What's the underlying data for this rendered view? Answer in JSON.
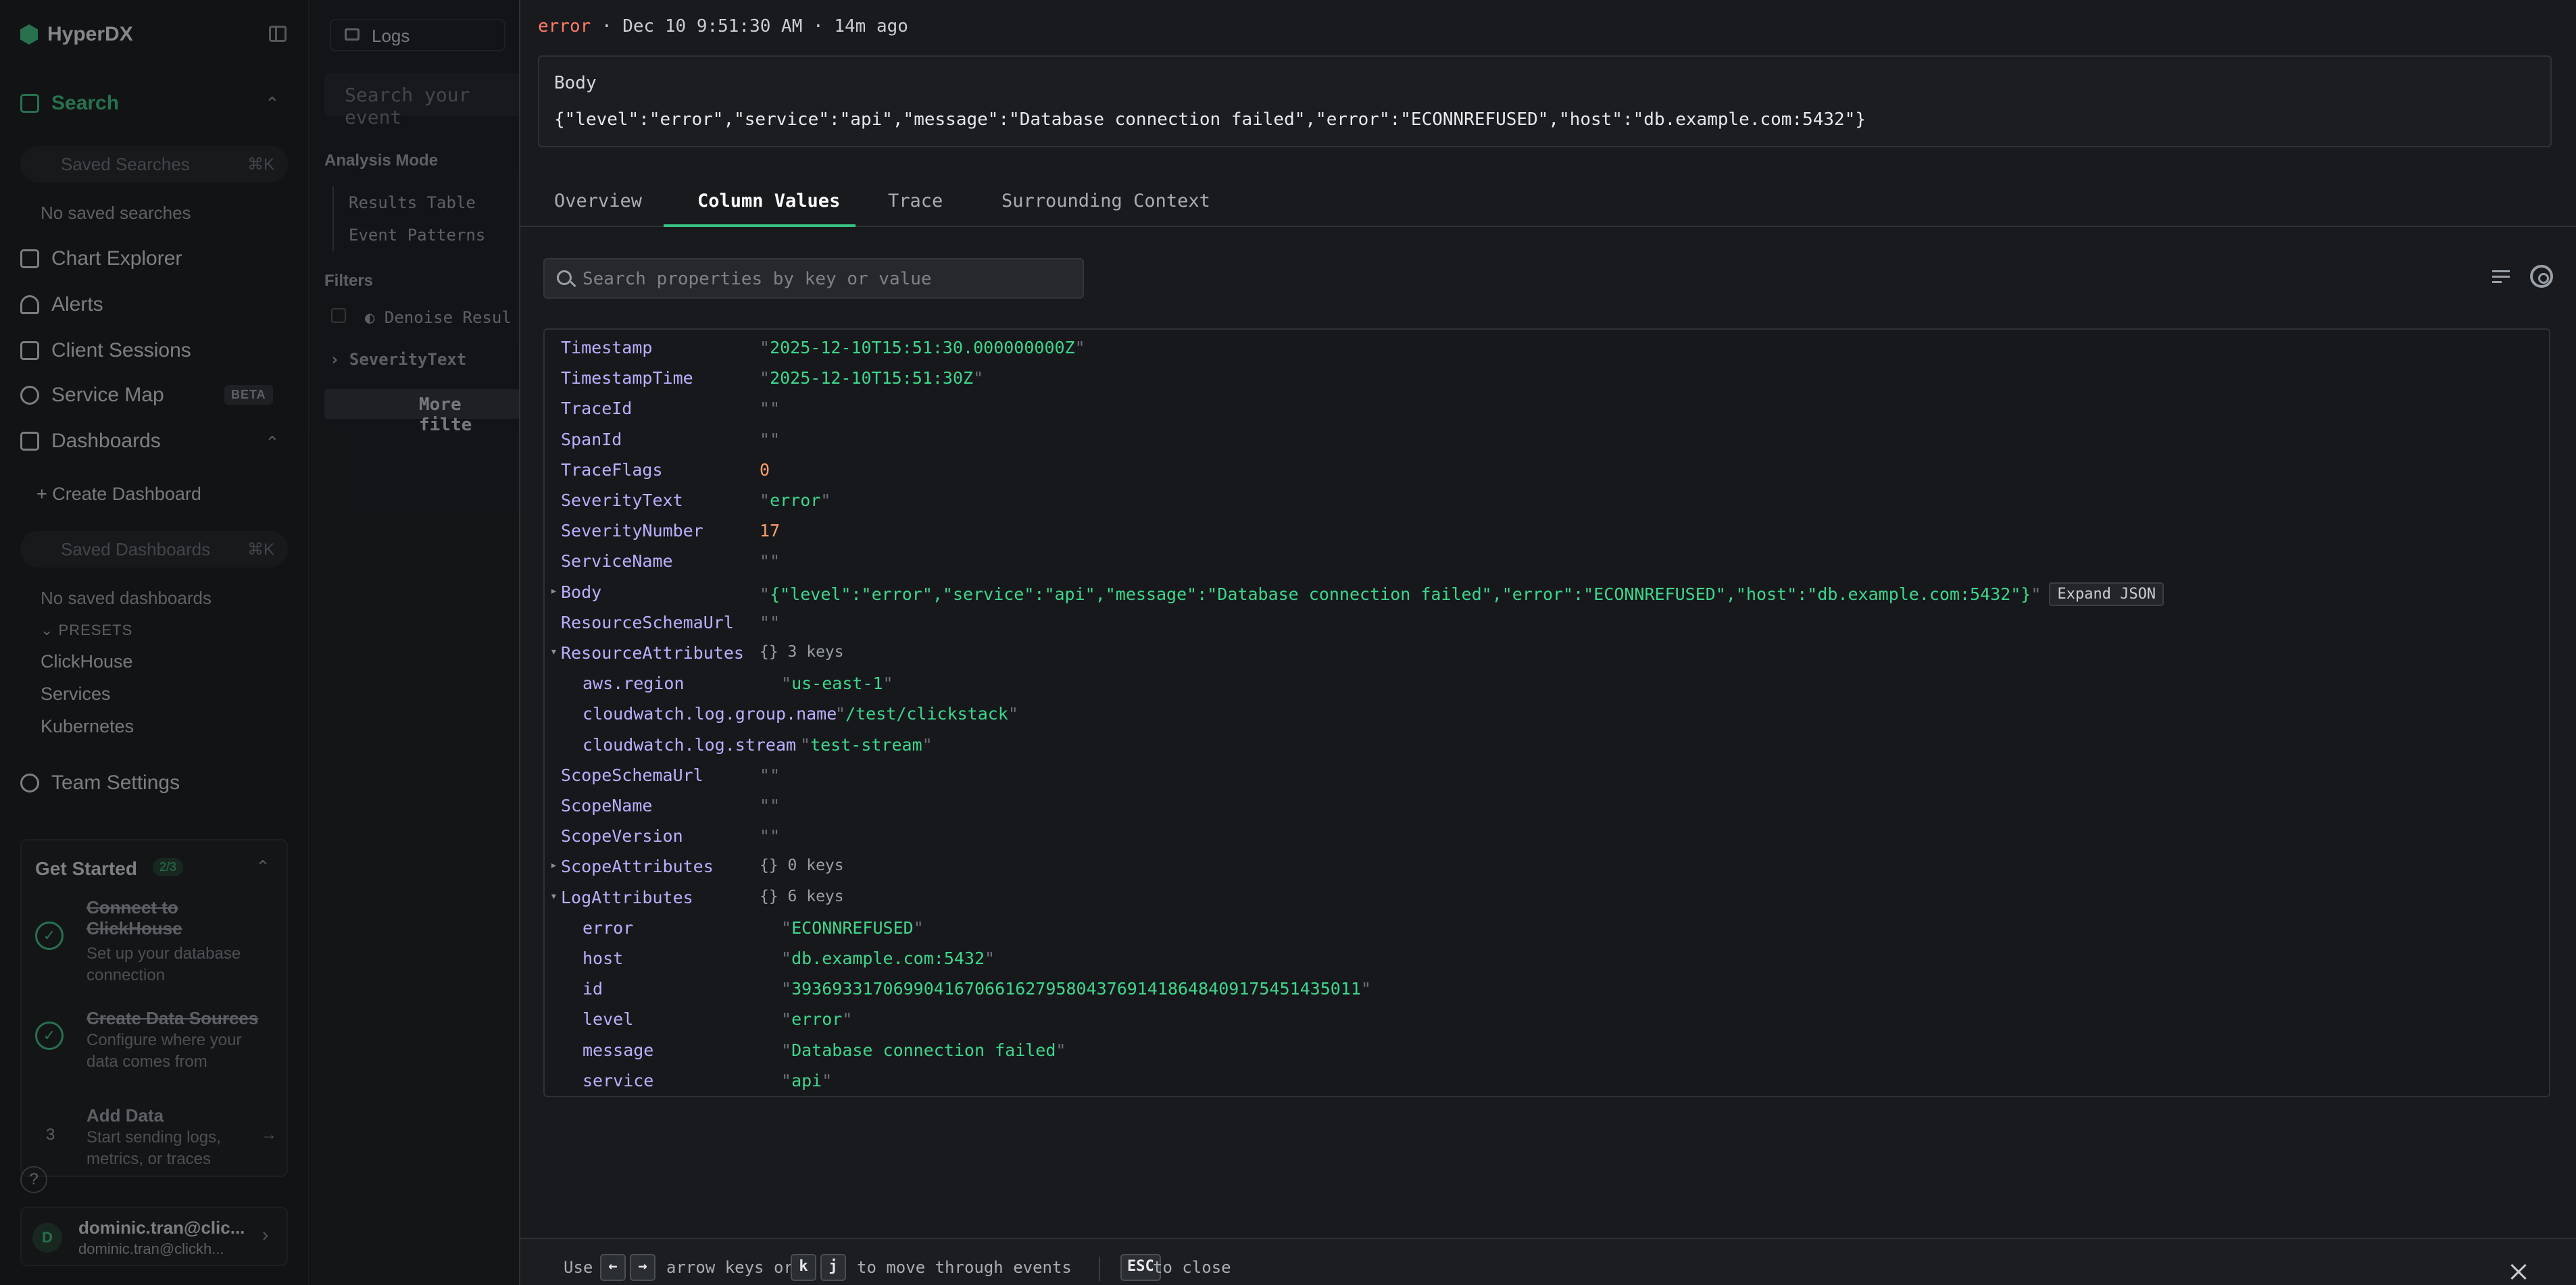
{
  "sidebar": {
    "app_name": "HyperDX",
    "search_label": "Search",
    "saved_searches_placeholder": "Saved Searches",
    "saved_searches_shortcut": "⌘K",
    "no_saved_searches": "No saved searches",
    "nav": {
      "chart_explorer": "Chart Explorer",
      "alerts": "Alerts",
      "client_sessions": "Client Sessions",
      "service_map": "Service Map",
      "beta": "BETA",
      "dashboards": "Dashboards"
    },
    "create_dashboard": "Create Dashboard",
    "saved_dashboards_placeholder": "Saved Dashboards",
    "saved_dashboards_shortcut": "⌘K",
    "no_saved_dashboards": "No saved dashboards",
    "presets_label": "PRESETS",
    "presets": [
      "ClickHouse",
      "Services",
      "Kubernetes"
    ],
    "team_settings": "Team Settings",
    "get_started": {
      "title": "Get Started",
      "progress": "2/3",
      "steps": [
        {
          "title": "Connect to ClickHouse",
          "desc": "Set up your database connection"
        },
        {
          "title": "Create Data Sources",
          "desc": "Configure where your data comes from"
        },
        {
          "num": "3",
          "title": "Add Data",
          "desc": "Start sending logs, metrics, or traces"
        }
      ]
    },
    "help": "?",
    "user": {
      "initial": "D",
      "name": "dominic.tran@clic...",
      "email": "dominic.tran@clickh..."
    }
  },
  "middle": {
    "source_tab": "Logs",
    "search_placeholder": "Search your event",
    "analysis_mode_label": "Analysis Mode",
    "results_table": "Results Table",
    "event_patterns": "Event Patterns",
    "filters_label": "Filters",
    "denoise": "Denoise Resul",
    "severity_text": "SeverityText",
    "more_filters": "More filte"
  },
  "panel": {
    "header": {
      "level": "error",
      "sep": "·",
      "time": "Dec 10 9:51:30 AM",
      "ago": "14m ago"
    },
    "body_label": "Body",
    "body_value": "{\"level\":\"error\",\"service\":\"api\",\"message\":\"Database connection failed\",\"error\":\"ECONNREFUSED\",\"host\":\"db.example.com:5432\"}",
    "tabs": [
      "Overview",
      "Column Values",
      "Trace",
      "Surrounding Context"
    ],
    "active_tab": "Column Values",
    "property_search_placeholder": "Search properties by key or value",
    "expand_json": "Expand JSON",
    "rows": [
      {
        "key": "Timestamp",
        "type": "str",
        "value": "2025-12-10T15:51:30.000000000Z"
      },
      {
        "key": "TimestampTime",
        "type": "str",
        "value": "2025-12-10T15:51:30Z"
      },
      {
        "key": "TraceId",
        "type": "str",
        "value": ""
      },
      {
        "key": "SpanId",
        "type": "str",
        "value": ""
      },
      {
        "key": "TraceFlags",
        "type": "num",
        "value": "0"
      },
      {
        "key": "SeverityText",
        "type": "str",
        "value": "error"
      },
      {
        "key": "SeverityNumber",
        "type": "num",
        "value": "17"
      },
      {
        "key": "ServiceName",
        "type": "str",
        "value": ""
      },
      {
        "key": "Body",
        "type": "str",
        "value": "{\"level\":\"error\",\"service\":\"api\",\"message\":\"Database connection failed\",\"error\":\"ECONNREFUSED\",\"host\":\"db.example.com:5432\"}",
        "expandable": true
      },
      {
        "key": "ResourceSchemaUrl",
        "type": "str",
        "value": ""
      },
      {
        "key": "ResourceAttributes",
        "type": "meta",
        "value": "{} 3 keys",
        "open": true
      },
      {
        "key": "aws.region",
        "type": "str",
        "value": "us-east-1",
        "child": true
      },
      {
        "key": "cloudwatch.log.group.name",
        "type": "str",
        "value": "/test/clickstack",
        "child": true
      },
      {
        "key": "cloudwatch.log.stream",
        "type": "str",
        "value": "test-stream",
        "child": true
      },
      {
        "key": "ScopeSchemaUrl",
        "type": "str",
        "value": ""
      },
      {
        "key": "ScopeName",
        "type": "str",
        "value": ""
      },
      {
        "key": "ScopeVersion",
        "type": "str",
        "value": ""
      },
      {
        "key": "ScopeAttributes",
        "type": "meta",
        "value": "{} 0 keys"
      },
      {
        "key": "LogAttributes",
        "type": "meta",
        "value": "{} 6 keys",
        "open": true
      },
      {
        "key": "error",
        "type": "str",
        "value": "ECONNREFUSED",
        "child": true
      },
      {
        "key": "host",
        "type": "str",
        "value": "db.example.com:5432",
        "child": true
      },
      {
        "key": "id",
        "type": "str",
        "value": "39369331706990416706616279580437691418648409175451435011",
        "child": true
      },
      {
        "key": "level",
        "type": "str",
        "value": "error",
        "child": true
      },
      {
        "key": "message",
        "type": "str",
        "value": "Database connection failed",
        "child": true
      },
      {
        "key": "service",
        "type": "str",
        "value": "api",
        "child": true
      }
    ],
    "footer": {
      "use": "Use",
      "left_key": "←",
      "right_key": "→",
      "arrow_text": "arrow keys or",
      "k_key": "k",
      "j_key": "j",
      "move_text": "to move through events",
      "esc_key": "ESC",
      "close_text": "to close"
    }
  },
  "colors": {
    "accent": "#39c07f",
    "key": "#b8b0ff",
    "string": "#3dd68c",
    "number": "#ff9f6a",
    "error": "#ff7a6a"
  }
}
